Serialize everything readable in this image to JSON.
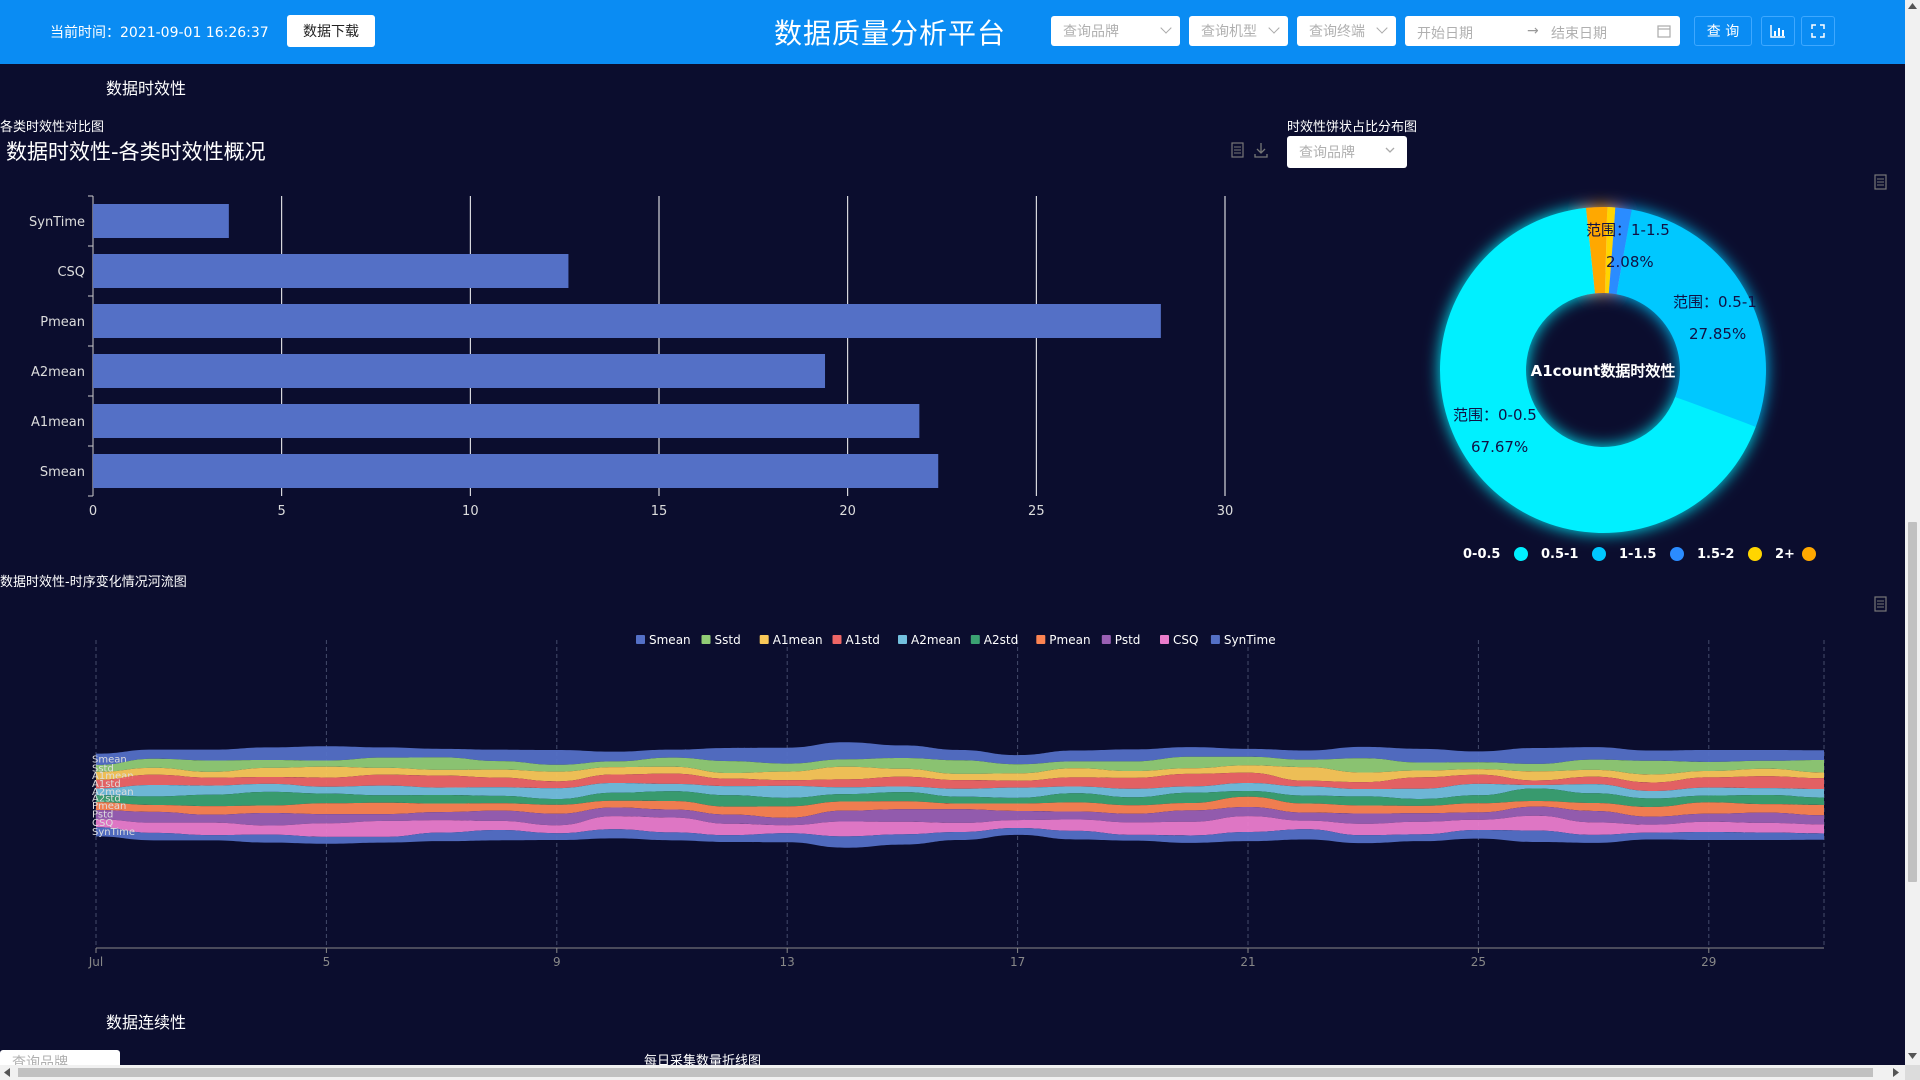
{
  "header": {
    "time_label": "当前时间：2021-09-01 16:26:37",
    "download_label": "数据下载",
    "title": "数据质量分析平台",
    "brand_placeholder": "查询品牌",
    "model_placeholder": "查询机型",
    "terminal_placeholder": "查询终端",
    "start_date_placeholder": "开始日期",
    "end_date_placeholder": "结束日期",
    "query_label": "查 询",
    "arrow": "→"
  },
  "sections": {
    "timeliness": "数据时效性",
    "continuity": "数据连续性"
  },
  "bar_panel": {
    "label": "各类时效性对比图",
    "title": "数据时效性-各类时效性概况"
  },
  "pie_panel": {
    "label": "时效性饼状占比分布图",
    "brand_placeholder": "查询品牌",
    "center_title": "A1count数据时效性"
  },
  "stream_panel": {
    "label": "数据时效性-时序变化情况河流图"
  },
  "line_panel": {
    "label": "每日采集数量折线图",
    "brand_placeholder": "查询品牌"
  },
  "colors": {
    "topbar": "#0a8cf3",
    "background": "#0b0d2e",
    "bar": "#5470c6"
  },
  "chart_data": [
    {
      "type": "bar",
      "orientation": "horizontal",
      "categories": [
        "SynTime",
        "CSQ",
        "Pmean",
        "A2mean",
        "A1mean",
        "Smean"
      ],
      "values": [
        3.6,
        12.6,
        28.3,
        19.4,
        21.9,
        22.4
      ],
      "xlim": [
        0,
        30
      ],
      "xticks": [
        "0",
        "5",
        "10",
        "15",
        "20",
        "25",
        "30"
      ],
      "grid": true
    },
    {
      "type": "pie",
      "style": "donut",
      "slices": [
        {
          "name": "0-0.5",
          "label": "范围：0-0.5",
          "percent_label": "67.67%",
          "value": 67.67,
          "color": "#00f0ff"
        },
        {
          "name": "0.5-1",
          "label": "范围：0.5-1",
          "percent_label": "27.85%",
          "value": 27.85,
          "color": "#00c8ff"
        },
        {
          "name": "1-1.5",
          "label": "",
          "percent_label": "",
          "value": 1.6,
          "color": "#2b8cff"
        },
        {
          "name": "1.5-2",
          "label": "",
          "percent_label": "",
          "value": 0.8,
          "color": "#ffd500"
        },
        {
          "name": "2+",
          "label": "范围：1-1.5",
          "percent_label": "2.08%",
          "value": 2.08,
          "color": "#ffa800"
        }
      ],
      "legend": [
        "0-0.5",
        "0.5-1",
        "1-1.5",
        "1.5-2",
        "2+"
      ],
      "legend_position": "bottom"
    },
    {
      "type": "area",
      "style": "streamgraph",
      "x_ticks": [
        "Jul",
        "5",
        "9",
        "13",
        "17",
        "21",
        "25",
        "29"
      ],
      "days": 31,
      "legend_position": "top",
      "series": [
        {
          "name": "Smean",
          "color": "#5470c6",
          "values": [
            20,
            16,
            19,
            22,
            25,
            18,
            15,
            20,
            26,
            17,
            14,
            23,
            28,
            30,
            22,
            18,
            16,
            19,
            21,
            17,
            14,
            16,
            20,
            24,
            19,
            28,
            22,
            18,
            21,
            19,
            17
          ]
        },
        {
          "name": "Sstd",
          "color": "#91cc75",
          "values": [
            12,
            16,
            20,
            14,
            11,
            18,
            22,
            15,
            12,
            10,
            16,
            21,
            14,
            13,
            19,
            24,
            16,
            12,
            17,
            20,
            15,
            13,
            25,
            14,
            12,
            13,
            18,
            24,
            16,
            14,
            22
          ]
        },
        {
          "name": "A1mean",
          "color": "#fac858",
          "values": [
            14,
            12,
            10,
            16,
            19,
            12,
            10,
            14,
            17,
            13,
            12,
            10,
            15,
            22,
            14,
            11,
            13,
            16,
            12,
            10,
            13,
            24,
            17,
            12,
            10,
            16,
            12,
            14,
            11,
            13,
            10
          ]
        },
        {
          "name": "A1std",
          "color": "#ee6666",
          "values": [
            15,
            18,
            14,
            12,
            16,
            19,
            21,
            17,
            12,
            15,
            18,
            13,
            10,
            14,
            17,
            15,
            12,
            16,
            19,
            22,
            18,
            10,
            12,
            20,
            16,
            8,
            13,
            15,
            18,
            21,
            19
          ]
        },
        {
          "name": "A2mean",
          "color": "#73c0de",
          "values": [
            12,
            20,
            16,
            14,
            12,
            17,
            13,
            15,
            19,
            17,
            13,
            16,
            21,
            12,
            10,
            14,
            18,
            12,
            15,
            11,
            14,
            16,
            13,
            18,
            20,
            6,
            16,
            13,
            14,
            12,
            15
          ]
        },
        {
          "name": "A2std",
          "color": "#3ba272",
          "values": [
            12,
            15,
            20,
            24,
            17,
            13,
            15,
            13,
            10,
            14,
            17,
            20,
            15,
            13,
            16,
            12,
            10,
            16,
            14,
            18,
            10,
            14,
            16,
            12,
            14,
            22,
            17,
            15,
            12,
            16,
            13
          ]
        },
        {
          "name": "Pmean",
          "color": "#fc8452",
          "values": [
            14,
            12,
            15,
            13,
            19,
            20,
            15,
            13,
            16,
            12,
            15,
            14,
            20,
            16,
            14,
            10,
            13,
            16,
            15,
            13,
            18,
            16,
            14,
            13,
            16,
            10,
            14,
            17,
            20,
            15,
            18
          ]
        },
        {
          "name": "Pstd",
          "color": "#9a60b4",
          "values": [
            16,
            19,
            14,
            22,
            16,
            12,
            14,
            18,
            20,
            15,
            14,
            16,
            13,
            19,
            22,
            24,
            16,
            14,
            15,
            20,
            16,
            14,
            18,
            15,
            13,
            16,
            20,
            14,
            14,
            18,
            16
          ]
        },
        {
          "name": "CSQ",
          "color": "#ea7ccc",
          "values": [
            14,
            18,
            22,
            16,
            24,
            28,
            22,
            16,
            14,
            23,
            26,
            20,
            14,
            26,
            22,
            16,
            14,
            20,
            22,
            24,
            28,
            15,
            20,
            22,
            18,
            26,
            22,
            14,
            18,
            17,
            16
          ]
        },
        {
          "name": "SynTime",
          "color": "#5470c6",
          "values": [
            16,
            13,
            9,
            14,
            12,
            10,
            15,
            18,
            12,
            16,
            14,
            12,
            16,
            20,
            18,
            14,
            12,
            15,
            10,
            13,
            16,
            18,
            14,
            12,
            15,
            20,
            14,
            12,
            14,
            13,
            11
          ]
        }
      ]
    }
  ]
}
